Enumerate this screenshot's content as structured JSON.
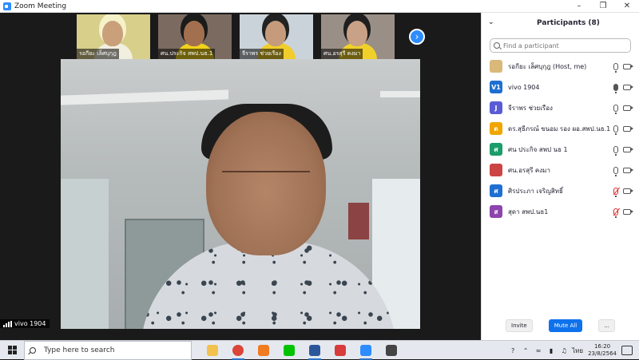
{
  "window": {
    "title": "Zoom Meeting"
  },
  "thumbnails": [
    {
      "name": "รอกียะ เล็ศบุกุฎ",
      "bg": "#d7cf8a",
      "skin": "#c9a07a",
      "shirt": "#f2efe0",
      "hair": "#f5f1c8"
    },
    {
      "name": "ศน.ประกิจ สพป.นธ.1",
      "bg": "#7a6a60",
      "skin": "#a2704f",
      "shirt": "#f2d21a",
      "hair": "#1b1b1b"
    },
    {
      "name": "จีราพร ช่วยเรือง",
      "bg": "#cbd3da",
      "skin": "#c59b7c",
      "shirt": "#f0cd2b",
      "hair": "#222222"
    },
    {
      "name": "ศน.อรสุรี คงมา",
      "bg": "#9a8f86",
      "skin": "#c8a186",
      "shirt": "#f1d029",
      "hair": "#1f1f1f"
    }
  ],
  "main_video": {
    "speaker_label": "vivo 1904"
  },
  "participants_panel": {
    "title": "Participants (8)",
    "search_placeholder": "Find a participant",
    "participants": [
      {
        "initials": "",
        "name": "รอกียะ เล็ศบุกุฎ (Host, me)",
        "avatar_color": "#d9b87a",
        "mic": "off",
        "cam": "on"
      },
      {
        "initials": "V1",
        "name": "vivo 1904",
        "avatar_color": "#1f6fd1",
        "mic": "on",
        "cam": "on"
      },
      {
        "initials": "J",
        "name": "จีราพร ช่วยเรือง",
        "avatar_color": "#5b5bd6",
        "mic": "off",
        "cam": "on"
      },
      {
        "initials": "ด",
        "name": "ดร.สุธีภรณ์ ขนอม รอง ผอ.สพป.นธ.1",
        "avatar_color": "#f0a500",
        "mic": "off",
        "cam": "on"
      },
      {
        "initials": "ศ",
        "name": "ศน ประกิจ สพป นธ 1",
        "avatar_color": "#1a9d6c",
        "mic": "off",
        "cam": "on"
      },
      {
        "initials": "",
        "name": "ศน.อรสุรี คงมา",
        "avatar_color": "#c44",
        "mic": "off",
        "cam": "on"
      },
      {
        "initials": "ศ",
        "name": "ศิรประภา เจริญสิทธิ์",
        "avatar_color": "#1f6fd1",
        "mic": "muted",
        "cam": "on"
      },
      {
        "initials": "ส",
        "name": "สุดา สพป.นธ1",
        "avatar_color": "#8e44ad",
        "mic": "muted",
        "cam": "on"
      }
    ],
    "invite_label": "Invite",
    "mute_all_label": "Mute All",
    "more_label": "..."
  },
  "taskbar": {
    "search_placeholder": "Type here to search",
    "apps": [
      {
        "name": "file-explorer",
        "color": "#f2c14e"
      },
      {
        "name": "chrome",
        "color": "#db4437"
      },
      {
        "name": "orange-app",
        "color": "#f07b20"
      },
      {
        "name": "line",
        "color": "#00c300"
      },
      {
        "name": "word",
        "color": "#2b579a"
      },
      {
        "name": "camera-app",
        "color": "#d83b3b"
      },
      {
        "name": "zoom",
        "color": "#2d8cff"
      },
      {
        "name": "settings",
        "color": "#444444"
      }
    ],
    "language": "ไทย",
    "time": "16:20",
    "date": "23/8/2564"
  }
}
